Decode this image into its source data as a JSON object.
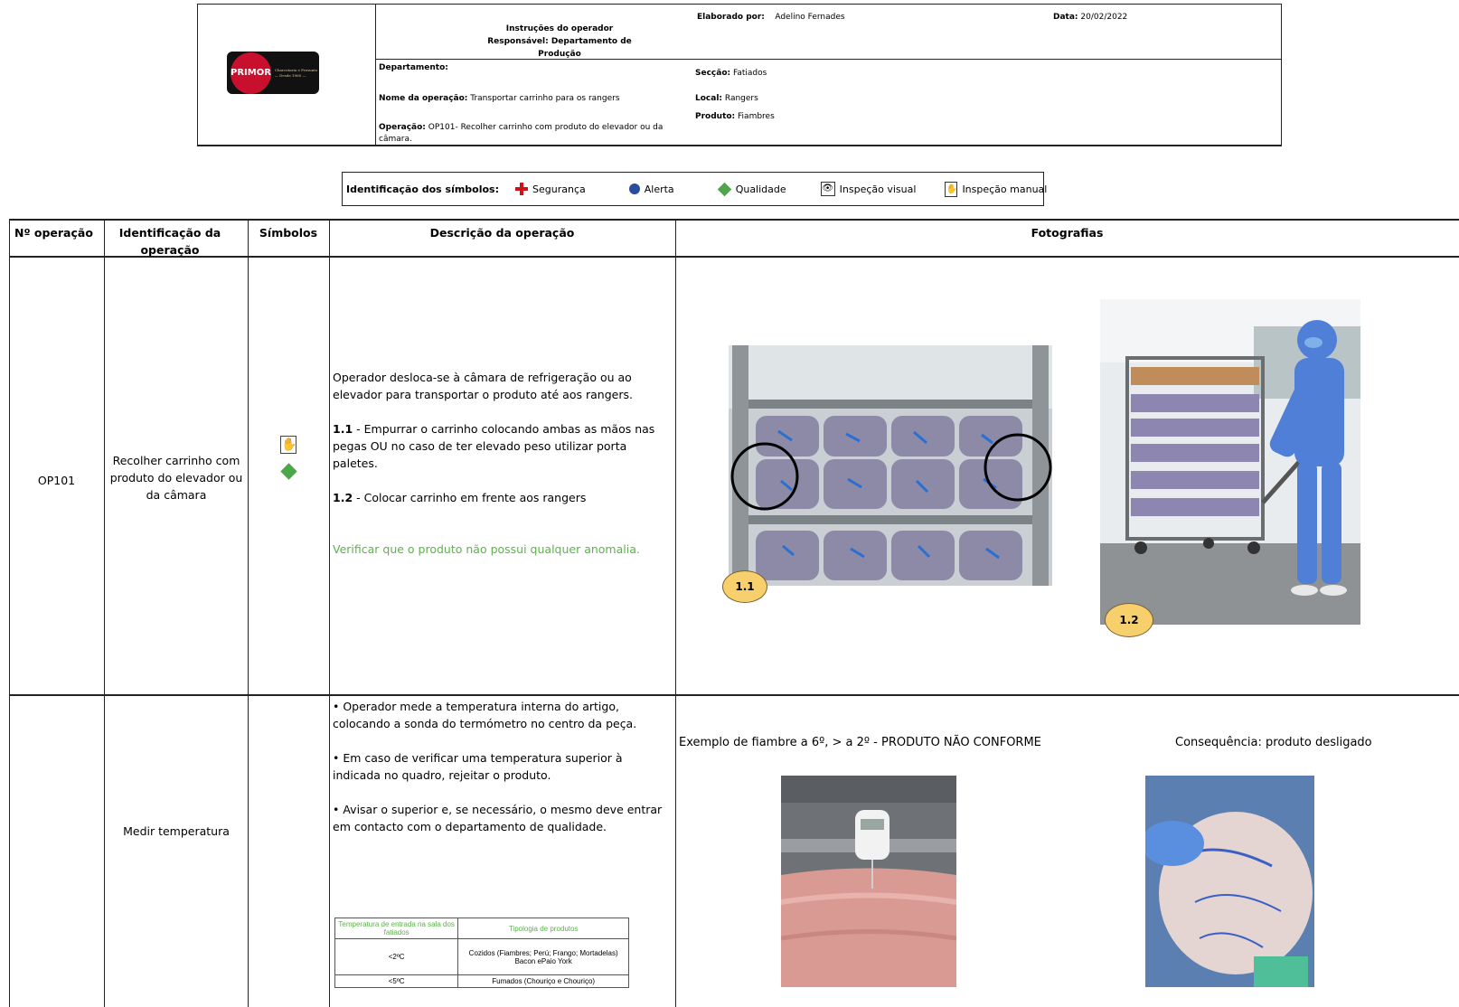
{
  "header": {
    "logo_text": "PRIMOR",
    "logo_tagline": "Charcutaria e Presunto — Desde 1960 —",
    "title_line1": "Instruções do operador",
    "title_line2": "Responsável: Departamento de Produção",
    "elaborado_label": "Elaborado por:",
    "elaborado_value": "Adelino Fernades",
    "data_label": "Data:",
    "data_value": "20/02/2022",
    "departamento_label": "Departamento:",
    "seccao_label": "Secção:",
    "seccao_value": "Fatiados",
    "nome_op_label": "Nome da operação:",
    "nome_op_value": "Transportar carrinho para os rangers",
    "local_label": "Local:",
    "local_value": "Rangers",
    "produto_label": "Produto:",
    "produto_value": "Fiambres",
    "operacao_label": "Operação:",
    "operacao_value": "OP101- Recolher carrinho com produto do elevador ou da câmara."
  },
  "legend": {
    "title": "Identificação dos símbolos:",
    "items": [
      {
        "icon": "red-cross-icon",
        "label": "Segurança",
        "color": "#d0111b"
      },
      {
        "icon": "blue-dot-icon",
        "label": "Alerta",
        "color": "#2a4c9c"
      },
      {
        "icon": "green-diamond-icon",
        "label": "Qualidade",
        "color": "#4ea64a"
      },
      {
        "icon": "eye-icon",
        "label": "Inspeção visual"
      },
      {
        "icon": "hand-icon",
        "label": "Inspeção manual"
      }
    ]
  },
  "table": {
    "headers": [
      "Nº operação",
      "Identificação da operação",
      "Símbolos",
      "Descrição da operação",
      "Fotografias"
    ],
    "rows": [
      {
        "num": "OP101",
        "ident": "Recolher carrinho com produto do elevador ou da câmara",
        "symbols": [
          "hand-icon",
          "green-diamond-icon"
        ],
        "desc_intro": "Operador desloca-se à câmara de refrigeração ou ao elevador para transportar o produto até aos rangers.",
        "step1_num": "1.1",
        "step1_text": "- Empurrar o carrinho colocando ambas as mãos nas pegas OU no caso de ter elevado peso utilizar porta paletes.",
        "step2_num": "1.2",
        "step2_text": "- Colocar carrinho em frente aos rangers",
        "quality_note": "Verificar que o produto não possui qualquer anomalia.",
        "photo_badges": [
          "1.1",
          "1.2"
        ]
      },
      {
        "ident": "Medir temperatura",
        "bullets": [
          "• Operador mede a temperatura interna do artigo, colocando a sonda do termómetro no centro da peça.",
          "• Em caso de verificar uma temperatura superior à indicada no quadro, rejeitar o produto.",
          "• Avisar o superior e, se necessário, o mesmo deve entrar em contacto com o departamento de qualidade."
        ],
        "temp_table": {
          "headers": [
            "Temperatura de entrada na sala dos fatiados",
            "Tipologia de produtos"
          ],
          "rows": [
            [
              "<2ºC",
              "Cozidos (Fiambres; Perú; Frango; Mortadelas) Bacon ePaio York"
            ],
            [
              "<5ºC",
              "Fumados (Chouriço e Chouriço)"
            ]
          ]
        },
        "caption_left": "Exemplo de fiambre a 6º, > a 2º - PRODUTO NÃO CONFORME",
        "caption_right": "Consequência: produto desligado"
      }
    ]
  }
}
